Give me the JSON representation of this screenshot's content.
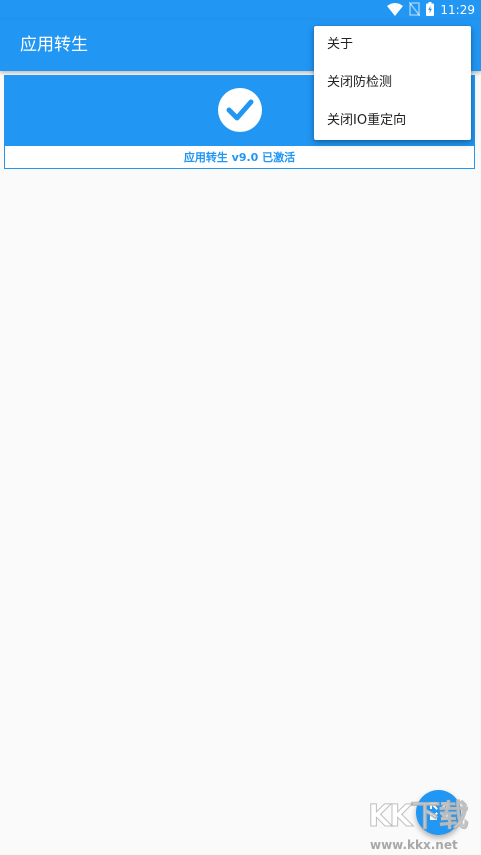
{
  "status_bar": {
    "time": "11:29",
    "icons": [
      "wifi-icon",
      "sim-off-icon",
      "battery-charging-icon"
    ]
  },
  "app_bar": {
    "title": "应用转生"
  },
  "status_card": {
    "icon": "check-icon",
    "label": "应用转生 v9.0 已激活"
  },
  "overflow_menu": {
    "items": [
      {
        "label": "关于"
      },
      {
        "label": "关闭防检测"
      },
      {
        "label": "关闭IO重定向"
      }
    ]
  },
  "fab": {
    "icon": "expand-icon"
  },
  "watermark": {
    "logo": "KK下载",
    "url": "www.kkx.net"
  },
  "colors": {
    "primary": "#2196f3",
    "background": "#fafafa",
    "menu_text": "#212121"
  }
}
